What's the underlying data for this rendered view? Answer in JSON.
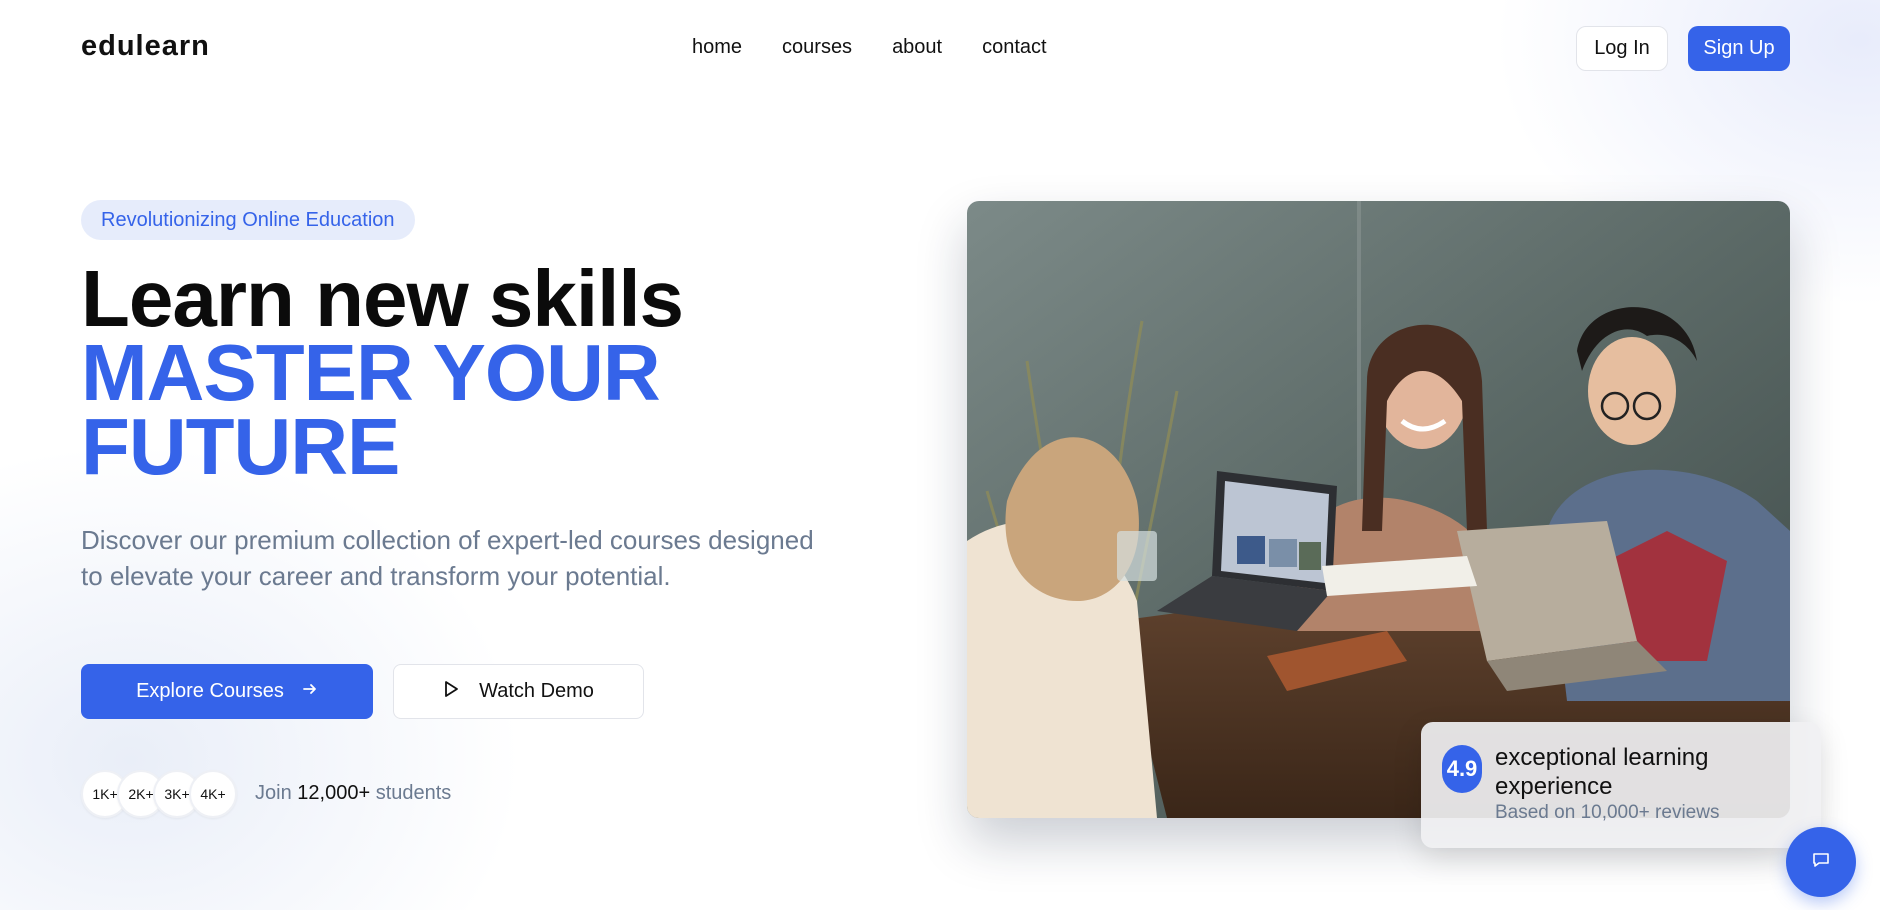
{
  "brand": {
    "logo_text": "eduLearn",
    "accent_color": "#3563e9"
  },
  "nav": {
    "items": [
      {
        "label": "Home"
      },
      {
        "label": "Courses"
      },
      {
        "label": "About"
      },
      {
        "label": "Contact"
      }
    ]
  },
  "auth": {
    "login_label": "Log In",
    "signup_label": "Sign Up"
  },
  "hero": {
    "badge": "Revolutionizing Online Education",
    "headline_line1": "Learn new skills",
    "headline_line2": "master your",
    "headline_line3": "future",
    "description": "Discover our premium collection of expert-led courses designed to elevate your career and transform your potential.",
    "primary_cta": "Explore Courses",
    "secondary_cta": "Watch Demo",
    "avatars": [
      "1K+",
      "2K+",
      "3K+",
      "4K+"
    ],
    "join_prefix": "Join",
    "join_count": "12,000+",
    "join_suffix": "students"
  },
  "rating_card": {
    "score": "4.9",
    "title": "Exceptional Learning Experience",
    "subtitle": "Based on 10,000+ reviews"
  },
  "icons": {
    "arrow": "arrow-right-icon",
    "play": "play-icon",
    "chat": "chat-icon"
  }
}
